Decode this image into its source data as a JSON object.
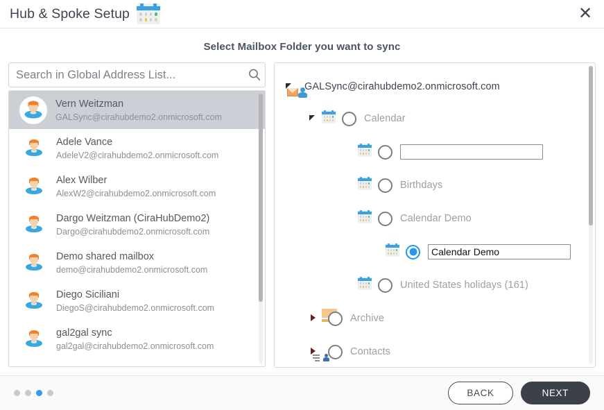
{
  "header": {
    "title": "Hub & Spoke Setup",
    "icon": "calendar-icon",
    "close_label": "✕"
  },
  "main": {
    "subtitle": "Select Mailbox Folder you want to sync"
  },
  "search": {
    "placeholder": "Search in Global Address List...",
    "value": "",
    "icon": "search-icon"
  },
  "gal_list": [
    {
      "name": "Vern Weitzman",
      "email": "GALSync@cirahubdemo2.onmicrosoft.com",
      "selected": true
    },
    {
      "name": "Adele Vance",
      "email": "AdeleV2@cirahubdemo2.onmicrosoft.com",
      "selected": false
    },
    {
      "name": "Alex Wilber",
      "email": "AlexW2@cirahubdemo2.onmicrosoft.com",
      "selected": false
    },
    {
      "name": "Dargo Weitzman (CiraHubDemo2)",
      "email": "Dargo@cirahubdemo2.onmicrosoft.com",
      "selected": false
    },
    {
      "name": "Demo shared mailbox",
      "email": "demo@cirahubdemo2.onmicrosoft.com",
      "selected": false
    },
    {
      "name": "Diego Siciliani",
      "email": "DiegoS@cirahubdemo2.onmicrosoft.com",
      "selected": false
    },
    {
      "name": "gal2gal sync",
      "email": "gal2gal@cirahubdemo2.onmicrosoft.com",
      "selected": false
    }
  ],
  "tree": [
    {
      "label": "GALSync@cirahubdemo2.onmicrosoft.com",
      "icon": "mail-user-icon",
      "twist": "open",
      "indent": 0,
      "radio": "none",
      "type": "label"
    },
    {
      "label": "Calendar",
      "icon": "calendar-icon",
      "twist": "open",
      "indent": 1,
      "radio": "unchecked",
      "type": "label"
    },
    {
      "label": "",
      "icon": "calendar-icon",
      "twist": "none",
      "indent": 2,
      "radio": "unchecked",
      "type": "input",
      "value": ""
    },
    {
      "label": "Birthdays",
      "icon": "calendar-icon",
      "twist": "none",
      "indent": 2,
      "radio": "unchecked",
      "type": "label"
    },
    {
      "label": "Calendar Demo",
      "icon": "calendar-icon",
      "twist": "none",
      "indent": 2,
      "radio": "unchecked",
      "type": "label"
    },
    {
      "label": "",
      "icon": "calendar-icon",
      "twist": "none",
      "indent": 3,
      "radio": "checked",
      "type": "input",
      "value": "Calendar Demo"
    },
    {
      "label": "United States holidays (161)",
      "icon": "calendar-icon",
      "twist": "none",
      "indent": 2,
      "radio": "unchecked",
      "type": "label"
    },
    {
      "label": "Archive",
      "icon": "folder-icon",
      "twist": "closed",
      "indent": 1,
      "radio": "unchecked",
      "type": "label"
    },
    {
      "label": "Contacts",
      "icon": "contacts-icon",
      "twist": "closed",
      "indent": 1,
      "radio": "unchecked",
      "type": "label"
    }
  ],
  "footer": {
    "steps": {
      "count": 4,
      "active_index": 2
    },
    "back_label": "BACK",
    "next_label": "NEXT"
  },
  "colors": {
    "accent": "#2f9fe8",
    "radio_checked": "#2196f3",
    "next_button": "#3c4048",
    "selected_row": "#ccd0d6"
  }
}
